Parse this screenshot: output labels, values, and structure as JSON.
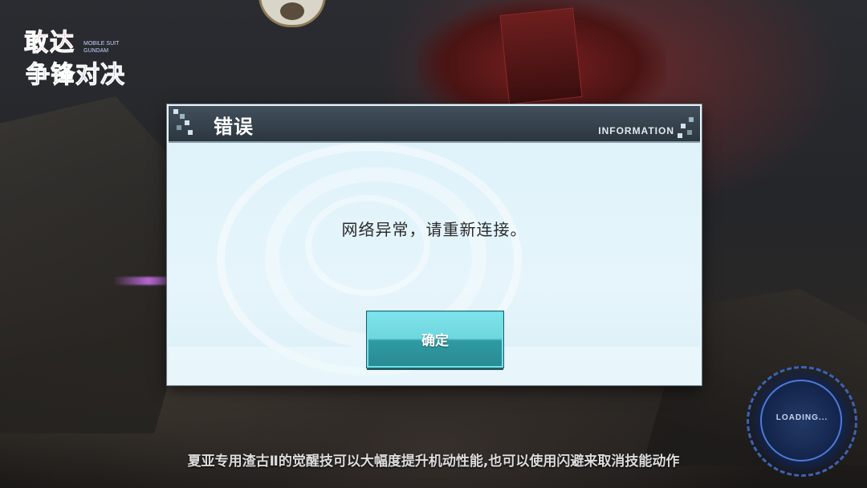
{
  "logo": {
    "line1": "敢达",
    "line2": "争锋对决",
    "sub": "MOBILE SUIT GUNDAM"
  },
  "dialog": {
    "title": "错误",
    "info_label": "INFORMATION",
    "message": "网络异常，请重新连接。",
    "confirm_label": "确定"
  },
  "loading": {
    "text": "LOADING..."
  },
  "tip": {
    "text": "夏亚专用渣古Ⅱ的觉醒技可以大幅度提升机动性能,也可以使用闪避来取消技能动作"
  },
  "colors": {
    "header_bg": "#2c363f",
    "dialog_bg": "#d9eff8",
    "button_top": "#7fe3ea",
    "button_bottom": "#2a8a92"
  },
  "icons": [
    "avatar-icon",
    "loading-icon"
  ]
}
